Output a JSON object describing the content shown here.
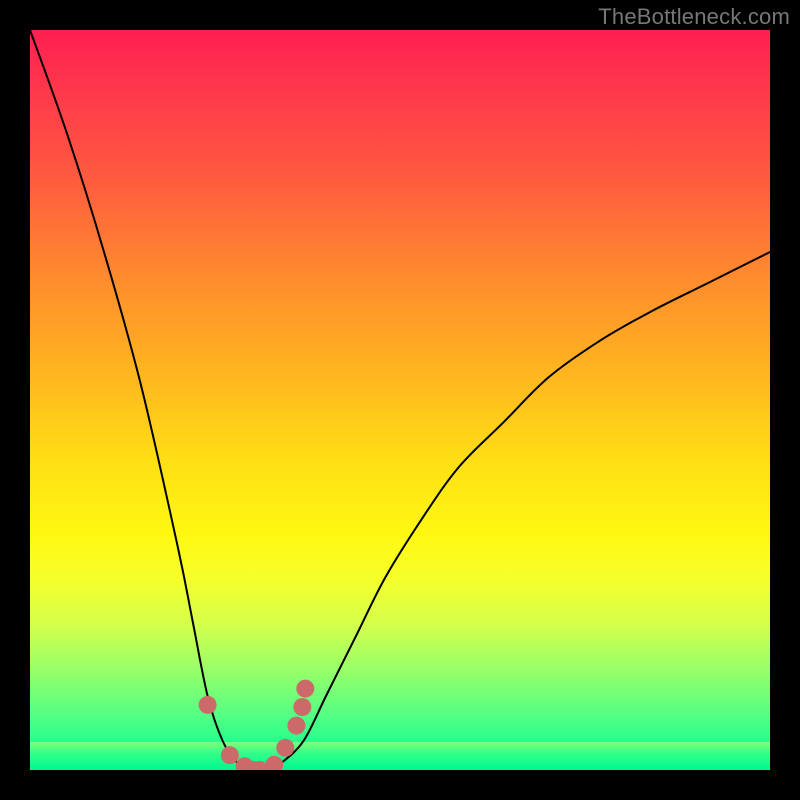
{
  "watermark": "TheBottleneck.com",
  "chart_data": {
    "type": "line",
    "title": "",
    "xlabel": "",
    "ylabel": "",
    "xlim": [
      0,
      1
    ],
    "ylim": [
      0,
      1
    ],
    "series": [
      {
        "name": "bottleneck-curve",
        "x": [
          0.0,
          0.05,
          0.1,
          0.15,
          0.2,
          0.22,
          0.24,
          0.26,
          0.28,
          0.3,
          0.32,
          0.34,
          0.37,
          0.4,
          0.44,
          0.48,
          0.53,
          0.58,
          0.64,
          0.7,
          0.77,
          0.84,
          0.92,
          1.0
        ],
        "values": [
          1.0,
          0.86,
          0.7,
          0.52,
          0.3,
          0.2,
          0.1,
          0.04,
          0.01,
          0.0,
          0.0,
          0.01,
          0.04,
          0.1,
          0.18,
          0.26,
          0.34,
          0.41,
          0.47,
          0.53,
          0.58,
          0.62,
          0.66,
          0.7
        ]
      }
    ],
    "markers": {
      "name": "trough-markers",
      "color": "#cc6a6a",
      "x": [
        0.24,
        0.27,
        0.29,
        0.3,
        0.31,
        0.33,
        0.345,
        0.36,
        0.368,
        0.372
      ],
      "values": [
        0.088,
        0.02,
        0.005,
        0.0,
        0.0,
        0.007,
        0.03,
        0.06,
        0.085,
        0.11
      ]
    },
    "gradient_stops": [
      {
        "pos": 0.0,
        "color": "#ff1f52"
      },
      {
        "pos": 0.09,
        "color": "#ff3a4a"
      },
      {
        "pos": 0.2,
        "color": "#ff5a3f"
      },
      {
        "pos": 0.33,
        "color": "#ff8a2e"
      },
      {
        "pos": 0.46,
        "color": "#ffb420"
      },
      {
        "pos": 0.58,
        "color": "#ffde15"
      },
      {
        "pos": 0.68,
        "color": "#fff812"
      },
      {
        "pos": 0.74,
        "color": "#f6ff2a"
      },
      {
        "pos": 0.8,
        "color": "#d6ff4a"
      },
      {
        "pos": 0.86,
        "color": "#9dff66"
      },
      {
        "pos": 0.92,
        "color": "#5bff82"
      },
      {
        "pos": 0.97,
        "color": "#1cff8e"
      },
      {
        "pos": 1.0,
        "color": "#00f890"
      }
    ]
  }
}
